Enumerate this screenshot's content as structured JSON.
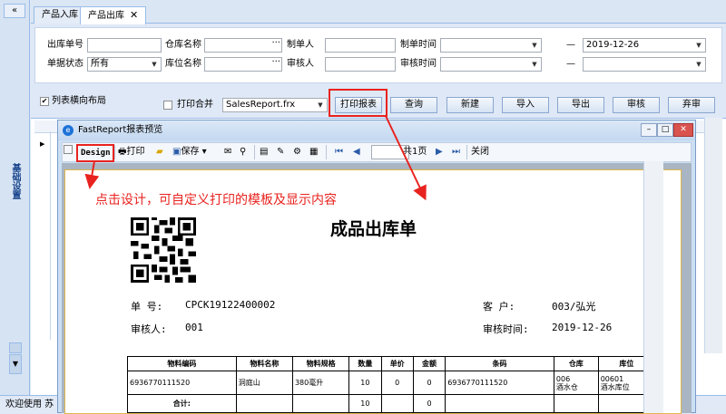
{
  "sidebar": {
    "collapse": "«",
    "title": "基础设置",
    "scroll_down": "▼"
  },
  "status": "欢迎使用 苏",
  "tabs": [
    {
      "label": "产品入库"
    },
    {
      "label": "产品出库",
      "close": "✕"
    }
  ],
  "form": {
    "outbound_no": {
      "label": "出库单号",
      "value": ""
    },
    "warehouse": {
      "label": "仓库名称",
      "value": ""
    },
    "maker": {
      "label": "制单人",
      "value": ""
    },
    "make_time": {
      "label": "制单时间",
      "value": ""
    },
    "date_sep": "—",
    "date_to": "2019-12-26",
    "doc_status": {
      "label": "单据状态",
      "value": "所有"
    },
    "location": {
      "label": "库位名称",
      "value": ""
    },
    "reviewer": {
      "label": "审核人",
      "value": ""
    },
    "review_time": {
      "label": "审核时间",
      "value": ""
    },
    "date_sep2": "—",
    "date_to2": ""
  },
  "toolbar": {
    "horizontal_layout": "列表横向布局",
    "print_merge": "打印合并",
    "report_file": "SalesReport.frx",
    "buttons": {
      "print_report": "打印报表",
      "query": "查询",
      "new": "新建",
      "import": "导入",
      "export": "导出",
      "review": "审核",
      "abandon": "弃审"
    }
  },
  "report_window": {
    "title": "FastReport报表预览",
    "toolbar": {
      "design": "Design",
      "print": "打印",
      "save": "保存",
      "page": "",
      "page_total": "共1页",
      "close": "关闭"
    },
    "annotation": "点击设计，可自定义打印的模板及显示内容"
  },
  "report": {
    "title": "成品出库单",
    "doc_no_label": "单  号:",
    "doc_no": "CPCK19122400002",
    "customer_label": "客    户:",
    "customer": "003/弘光",
    "reviewer_label": "审核人:",
    "reviewer": "001",
    "review_time_label": "审核时间:",
    "review_time": "2019-12-26",
    "table": {
      "headers": [
        "物料编码",
        "物料名称",
        "物料规格",
        "数量",
        "单价",
        "金额",
        "条码",
        "仓库",
        "库位"
      ],
      "rows": [
        [
          "6936770111520",
          "洞庭山",
          "380毫升",
          "10",
          "0",
          "0",
          "6936770111520",
          "006\n酒水仓",
          "00601\n酒水库位"
        ]
      ],
      "total_label": "合计:",
      "total_qty": "10",
      "total_amount": "0"
    }
  },
  "colors": {
    "accent_border": "#99bbe8",
    "highlight_red": "#e8231f",
    "paper_border": "#e0b84b"
  }
}
